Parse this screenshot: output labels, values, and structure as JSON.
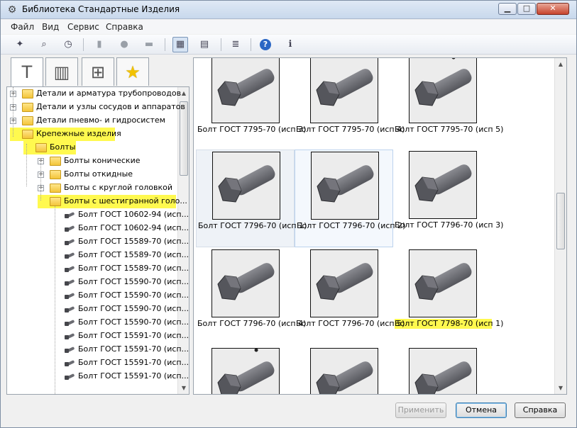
{
  "window": {
    "title": "Библиотека Стандартные Изделия",
    "minimize_label": "▁",
    "maximize_label": "□",
    "close_label": "✕"
  },
  "menu": [
    "Файл",
    "Вид",
    "Сервис",
    "Справка"
  ],
  "toolbar": {
    "buttons": [
      {
        "icon": "pin-star-icon",
        "glyph": "✦",
        "state": "normal"
      },
      {
        "icon": "binoculars-icon",
        "glyph": "⌕",
        "state": "normal"
      },
      {
        "icon": "clock-icon",
        "glyph": "◷",
        "state": "normal"
      },
      {
        "icon": "document-icon",
        "glyph": "▮",
        "state": "disabled"
      },
      {
        "icon": "circle-icon",
        "glyph": "●",
        "state": "disabled"
      },
      {
        "icon": "printer-icon",
        "glyph": "▬",
        "state": "disabled"
      },
      {
        "icon": "large-icons-view-icon",
        "glyph": "▦",
        "state": "active"
      },
      {
        "icon": "table-view-icon",
        "glyph": "▤",
        "state": "normal"
      },
      {
        "icon": "list-view-icon",
        "glyph": "≣",
        "state": "normal"
      },
      {
        "icon": "help-icon",
        "glyph": "?",
        "state": "normal"
      },
      {
        "icon": "info-icon",
        "glyph": "ℹ",
        "state": "normal"
      }
    ]
  },
  "tabs": [
    {
      "icon": "bolt-fastener-icon",
      "glyph": "T",
      "active": true
    },
    {
      "icon": "section-drawing-icon",
      "glyph": "▥",
      "active": false
    },
    {
      "icon": "assembly-icon",
      "glyph": "⊞",
      "active": false
    },
    {
      "icon": "favorites-star-icon",
      "glyph": "★",
      "active": false
    }
  ],
  "tree": {
    "items": [
      {
        "label": "Детали и арматура трубопроводов",
        "level": 0,
        "type": "folder",
        "expander": "+",
        "highlight": false
      },
      {
        "label": "Детали и узлы сосудов и аппаратов",
        "level": 0,
        "type": "folder",
        "expander": "+",
        "highlight": false
      },
      {
        "label": "Детали пневмо- и гидросистем",
        "level": 0,
        "type": "folder",
        "expander": "+",
        "highlight": false
      },
      {
        "label": "Крепежные изделия",
        "level": 0,
        "type": "folder",
        "expander": "−",
        "highlight": true
      },
      {
        "label": "Болты",
        "level": 1,
        "type": "folder",
        "expander": "−",
        "highlight": true
      },
      {
        "label": "Болты конические",
        "level": 2,
        "type": "folder",
        "expander": "+",
        "highlight": false
      },
      {
        "label": "Болты откидные",
        "level": 2,
        "type": "folder",
        "expander": "+",
        "highlight": false
      },
      {
        "label": "Болты с круглой головкой",
        "level": 2,
        "type": "folder",
        "expander": "+",
        "highlight": false
      },
      {
        "label": "Болты с шестигранной голо...",
        "level": 2,
        "type": "folder",
        "expander": "−",
        "highlight": true
      },
      {
        "label": "Болт ГОСТ 10602-94 (исп...",
        "level": 3,
        "type": "item",
        "expander": "",
        "highlight": false
      },
      {
        "label": "Болт ГОСТ 10602-94 (исп...",
        "level": 3,
        "type": "item",
        "expander": "",
        "highlight": false
      },
      {
        "label": "Болт ГОСТ 15589-70 (исп...",
        "level": 3,
        "type": "item",
        "expander": "",
        "highlight": false
      },
      {
        "label": "Болт ГОСТ 15589-70 (исп...",
        "level": 3,
        "type": "item",
        "expander": "",
        "highlight": false
      },
      {
        "label": "Болт ГОСТ 15589-70 (исп...",
        "level": 3,
        "type": "item",
        "expander": "",
        "highlight": false
      },
      {
        "label": "Болт ГОСТ 15590-70 (исп...",
        "level": 3,
        "type": "item",
        "expander": "",
        "highlight": false
      },
      {
        "label": "Болт ГОСТ 15590-70 (исп...",
        "level": 3,
        "type": "item",
        "expander": "",
        "highlight": false
      },
      {
        "label": "Болт ГОСТ 15590-70 (исп...",
        "level": 3,
        "type": "item",
        "expander": "",
        "highlight": false
      },
      {
        "label": "Болт ГОСТ 15590-70 (исп...",
        "level": 3,
        "type": "item",
        "expander": "",
        "highlight": false
      },
      {
        "label": "Болт ГОСТ 15591-70 (исп...",
        "level": 3,
        "type": "item",
        "expander": "",
        "highlight": false
      },
      {
        "label": "Болт ГОСТ 15591-70 (исп...",
        "level": 3,
        "type": "item",
        "expander": "",
        "highlight": false
      },
      {
        "label": "Болт ГОСТ 15591-70 (исп...",
        "level": 3,
        "type": "item",
        "expander": "",
        "highlight": false
      },
      {
        "label": "Болт ГОСТ 15591-70 (исп...",
        "level": 3,
        "type": "item",
        "expander": "",
        "highlight": false
      }
    ]
  },
  "grid": {
    "items": [
      {
        "label": "Болт ГОСТ 7795-70 (исп 3)",
        "selected": false,
        "highlight": false
      },
      {
        "label": "Болт ГОСТ 7795-70 (исп 4)",
        "selected": false,
        "highlight": false
      },
      {
        "label": "Болт ГОСТ 7795-70 (исп 5)",
        "selected": false,
        "highlight": false
      },
      {
        "label": "Болт ГОСТ 7796-70 (исп 1)",
        "selected": true,
        "highlight": false
      },
      {
        "label": "Болт ГОСТ 7796-70 (исп 2)",
        "selected": true,
        "highlight": false
      },
      {
        "label": "Болт ГОСТ 7796-70 (исп 3)",
        "selected": false,
        "highlight": false
      },
      {
        "label": "Болт ГОСТ 7796-70 (исп 4)",
        "selected": false,
        "highlight": false
      },
      {
        "label": "Болт ГОСТ 7796-70 (исп 5)",
        "selected": false,
        "highlight": false
      },
      {
        "label": "Болт ГОСТ 7798-70 (исп 1)",
        "selected": false,
        "highlight": true
      },
      {
        "label": "",
        "selected": false,
        "highlight": false
      },
      {
        "label": "",
        "selected": false,
        "highlight": false
      },
      {
        "label": "",
        "selected": false,
        "highlight": false
      }
    ]
  },
  "buttons": {
    "apply": "Применить",
    "cancel": "Отмена",
    "help": "Справка"
  },
  "colors": {
    "highlight": "#fff94f",
    "bolt_dark": "#55565c",
    "bolt_light": "#8a8b91"
  }
}
